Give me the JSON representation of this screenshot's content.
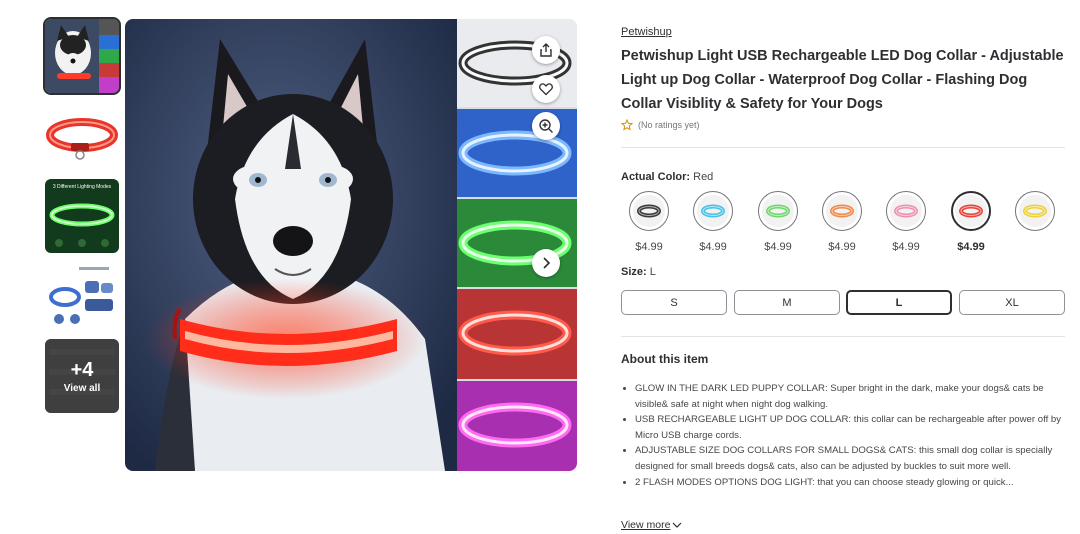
{
  "gallery": {
    "thumbnails": [
      {
        "name": "thumb-husky-collage",
        "selected": true
      },
      {
        "name": "thumb-red-collar"
      },
      {
        "name": "thumb-lighting-modes",
        "caption": "3 Different Lighting Modes"
      },
      {
        "name": "thumb-usb-diagram"
      }
    ],
    "view_all": {
      "count": "+4",
      "label": "View all"
    },
    "actions": {
      "share_icon": "share-icon",
      "favorite_icon": "heart-icon",
      "zoom_icon": "zoom-in-icon",
      "next_icon": "chevron-right-icon"
    }
  },
  "product": {
    "brand": "Petwishup",
    "title": "Petwishup Light USB Rechargeable LED Dog Collar - Adjustable Light up Dog Collar - Waterproof Dog Collar - Flashing Dog Collar Visiblity & Safety for Your Dogs",
    "rating_text": "(No ratings yet)"
  },
  "color_selector": {
    "label": "Actual Color:",
    "selected_value": "Red",
    "options": [
      {
        "name": "black",
        "color": "#3a3a3a",
        "price": "$4.99"
      },
      {
        "name": "blue",
        "color": "#45c2e8",
        "price": "$4.99"
      },
      {
        "name": "green",
        "color": "#6fd86a",
        "price": "$4.99"
      },
      {
        "name": "orange",
        "color": "#ef8a4a",
        "price": "$4.99"
      },
      {
        "name": "pink",
        "color": "#f08fb0",
        "price": "$4.99"
      },
      {
        "name": "red",
        "color": "#e8443a",
        "price": "$4.99",
        "selected": true
      },
      {
        "name": "yellow",
        "color": "#ecd23a",
        "price": ""
      }
    ]
  },
  "size_selector": {
    "label": "Size:",
    "selected_value": "L",
    "options": [
      "S",
      "M",
      "L",
      "XL"
    ]
  },
  "about": {
    "title": "About this item",
    "bullets": [
      "GLOW IN THE DARK LED PUPPY COLLAR: Super bright in the dark, make your dogs& cats be visible& safe at night when night dog walking.",
      "USB RECHARGEABLE LIGHT UP DOG COLLAR: this collar can be rechargeable after power off by Micro USB charge cords.",
      "ADJUSTABLE SIZE DOG COLLARS FOR SMALL DOGS& CATS: this small dog collar is specially designed for small breeds dogs& cats, also can be adjusted by buckles to suit more well.",
      "2 FLASH MODES OPTIONS DOG LIGHT: that you can choose steady glowing or quick..."
    ],
    "view_more": "View more"
  },
  "colors": {
    "text": "#2e2f32",
    "muted": "#74767c",
    "star": "#f2a100"
  }
}
